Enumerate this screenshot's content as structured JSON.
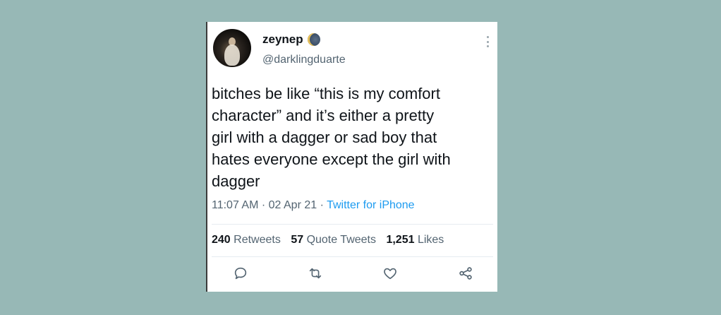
{
  "tweet": {
    "display_name": "zeynep",
    "handle": "@darklingduarte",
    "text": "bitches be like “this is my comfort\ncharacter” and it’s either a pretty\ngirl with a dagger or sad boy that\nhates everyone except the girl with\ndagger",
    "time": "11:07 AM",
    "date": "02 Apr 21",
    "separator": " · ",
    "source": "Twitter for iPhone"
  },
  "stats": {
    "retweets_count": "240",
    "retweets_label": "Retweets",
    "quote_count": "57",
    "quote_label": "Quote Tweets",
    "likes_count": "1,251",
    "likes_label": "Likes"
  },
  "icons": {
    "badge": "moon-icon",
    "more": "more-icon",
    "reply": "reply-icon",
    "retweet": "retweet-icon",
    "like": "heart-icon",
    "share": "share-icon"
  },
  "colors": {
    "background": "#97b8b6",
    "card": "#ffffff",
    "text": "#0f1419",
    "secondary": "#536471",
    "link": "#1d9bf0"
  }
}
